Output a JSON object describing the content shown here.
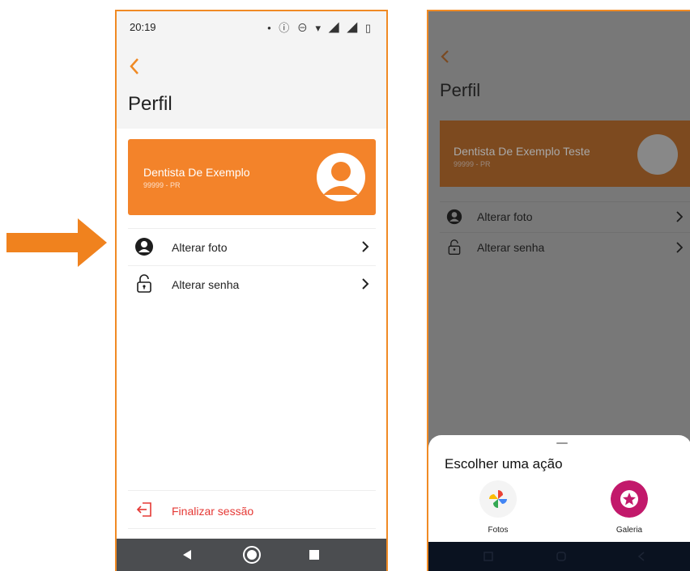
{
  "left_screen": {
    "status_bar": {
      "time": "20:19",
      "icons": "• ⓘ ⊖ ▾ ◢ ◢ ▯"
    },
    "header": {
      "title": "Perfil"
    },
    "profile_card": {
      "name": "Dentista De Exemplo",
      "subtitle": "99999 - PR"
    },
    "menu": [
      {
        "label": "Alterar foto",
        "icon": "user-circle-icon"
      },
      {
        "label": "Alterar senha",
        "icon": "unlock-icon"
      }
    ],
    "logout": {
      "label": "Finalizar sessão",
      "icon": "logout-icon"
    },
    "nav": [
      "back-icon",
      "home-icon",
      "recents-icon"
    ]
  },
  "right_screen": {
    "header": {
      "title": "Perfil"
    },
    "profile_card": {
      "name": "Dentista De Exemplo Teste",
      "subtitle": "99999 - PR"
    },
    "menu": [
      {
        "label": "Alterar foto",
        "icon": "user-circle-icon"
      },
      {
        "label": "Alterar senha",
        "icon": "unlock-icon"
      }
    ],
    "action_sheet": {
      "title": "Escolher uma ação",
      "apps": [
        {
          "label": "Fotos",
          "icon": "google-photos-icon"
        },
        {
          "label": "Galeria",
          "icon": "gallery-icon"
        }
      ]
    }
  },
  "colors": {
    "accent": "#F3832A",
    "danger": "#E53935",
    "frame": "#F08A24"
  }
}
